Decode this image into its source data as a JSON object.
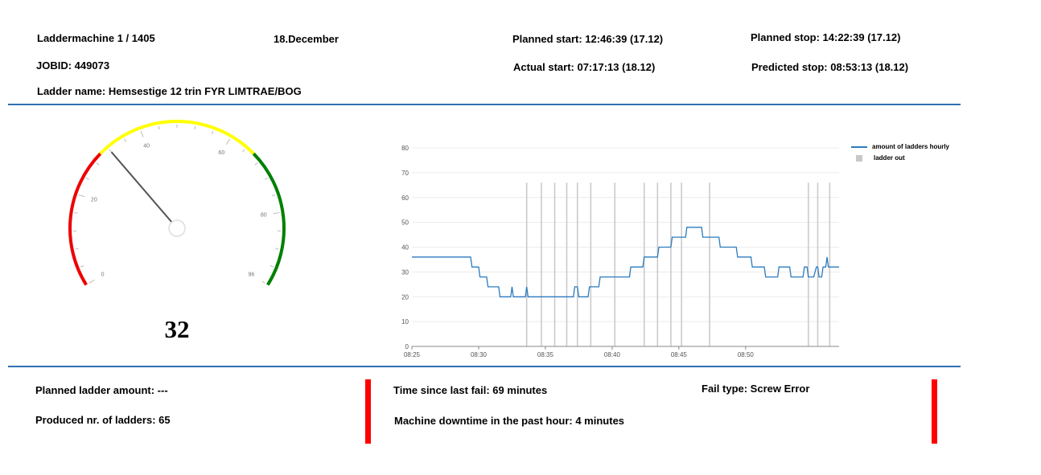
{
  "header": {
    "machine": "Laddermachine 1 / 1405",
    "date": "18.December",
    "planned_start": "Planned start: 12:46:39 (17.12)",
    "planned_stop": "Planned stop: 14:22:39 (17.12)",
    "jobid": "JOBID: 449073",
    "actual_start": "Actual start: 07:17:13 (18.12)",
    "predicted_stop": "Predicted stop: 08:53:13 (18.12)",
    "ladder_name": "Ladder name: Hemsestige 12 trin FYR LIMTRAE/BOG"
  },
  "gauge": {
    "value": 32,
    "value_label": "32",
    "min": 0,
    "max": 96,
    "ticks": [
      "0",
      "20",
      "40",
      "60",
      "80",
      "96"
    ],
    "bands": [
      {
        "from": 0,
        "to": 30,
        "color": "#ee0000"
      },
      {
        "from": 30,
        "to": 66,
        "color": "#ffff00"
      },
      {
        "from": 66,
        "to": 96,
        "color": "#008000"
      }
    ]
  },
  "chart_data": {
    "type": "line",
    "x_ticks": [
      "08:25",
      "08:30",
      "08:35",
      "08:40",
      "08:45",
      "08:50"
    ],
    "ylim": [
      0,
      80
    ],
    "y_ticks": [
      0,
      10,
      20,
      30,
      40,
      50,
      60,
      70,
      80
    ],
    "grid": true,
    "legend_position": "top-right",
    "series": [
      {
        "name": "amount of ladders hourly",
        "color": "#2b7bbf",
        "x_minutes": [
          0,
          4.4,
          4.5,
          5.0,
          5.1,
          5.6,
          5.7,
          6.5,
          6.6,
          7.4,
          7.5,
          7.6,
          8.5,
          8.6,
          8.7,
          12.1,
          12.2,
          12.4,
          12.5,
          13.2,
          13.3,
          14.0,
          14.1,
          16.3,
          16.4,
          17.3,
          17.4,
          18.4,
          18.5,
          19.4,
          19.5,
          20.5,
          20.6,
          21.7,
          21.8,
          23.0,
          23.1,
          24.3,
          24.4,
          25.4,
          25.5,
          26.4,
          26.5,
          27.4,
          27.5,
          28.3,
          28.4,
          29.3,
          29.4,
          29.6,
          29.7,
          30.1,
          30.3,
          30.4,
          30.5,
          30.7,
          30.8,
          31.0,
          31.1,
          31.2,
          31.3,
          32.0
        ],
        "values": [
          36,
          36,
          32,
          32,
          28,
          28,
          24,
          24,
          20,
          20,
          24,
          20,
          20,
          24,
          20,
          20,
          24,
          24,
          20,
          20,
          24,
          24,
          28,
          28,
          32,
          32,
          36,
          36,
          40,
          40,
          44,
          44,
          48,
          48,
          44,
          44,
          40,
          40,
          36,
          36,
          32,
          32,
          28,
          28,
          32,
          32,
          28,
          28,
          32,
          32,
          28,
          28,
          32,
          32,
          28,
          28,
          32,
          32,
          36,
          32,
          32,
          32
        ]
      },
      {
        "name": "ladder out",
        "color": "#c8c8c8",
        "x_minutes": [
          8.6,
          9.7,
          10.7,
          11.6,
          12.4,
          13.4,
          15.2,
          17.4,
          18.4,
          19.4,
          20.2,
          22.3,
          29.7,
          30.4,
          31.3
        ]
      }
    ]
  },
  "footer": {
    "planned_amount": "Planned ladder amount: ---",
    "produced": "Produced nr. of ladders: 65",
    "time_since_fail": "Time since last fail: 69 minutes",
    "downtime": "Machine downtime in the past hour: 4 minutes",
    "fail_type": "Fail type: Screw Error",
    "status_color": "#ff0000"
  }
}
